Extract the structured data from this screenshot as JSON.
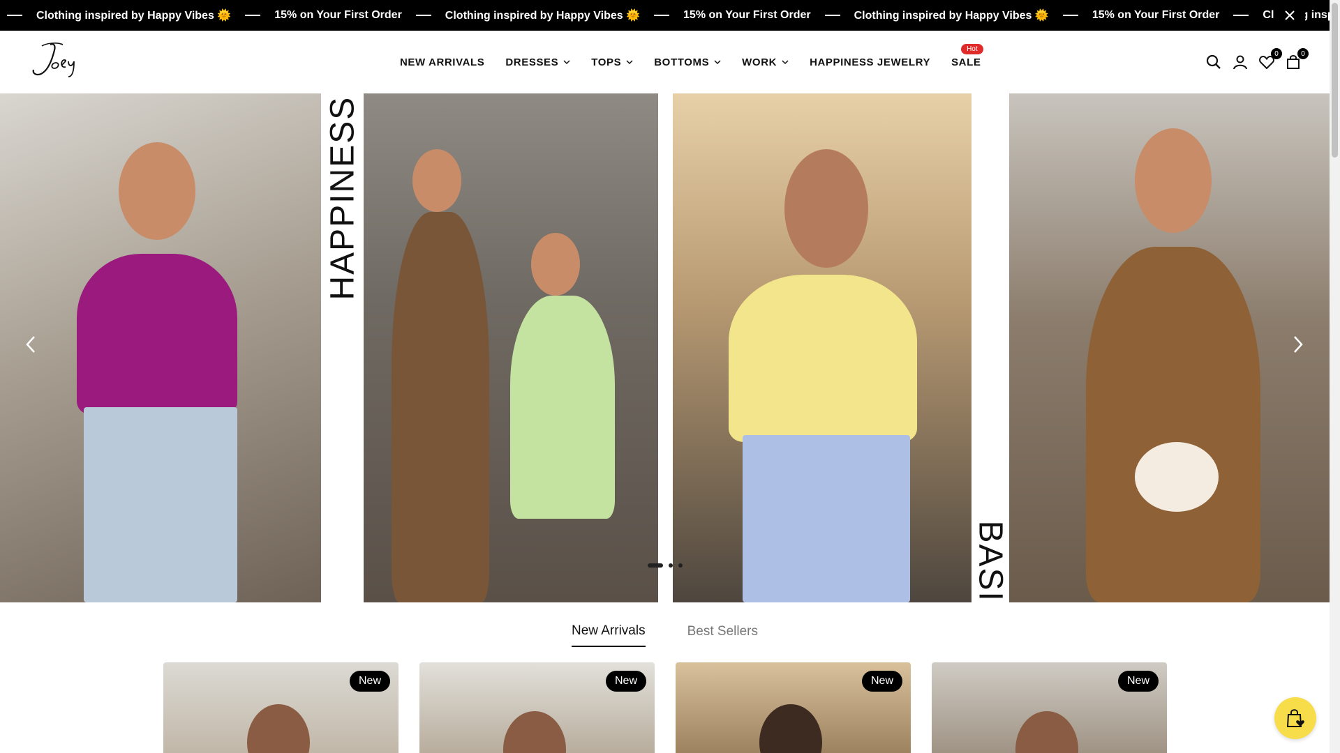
{
  "announcement": {
    "messages": [
      "Clothing inspired by Happy Vibes",
      "15% on Your First Order",
      "Clothing inspired by Happy Vibes",
      "15% on Your First Order",
      "Clothing inspired by Happy Vibes",
      "15% on Your First Order",
      "Clothing inspired"
    ],
    "sun_glyph": "🌞"
  },
  "header": {
    "logo_text": "Joey",
    "nav": [
      {
        "label": "NEW ARRIVALS",
        "dropdown": false
      },
      {
        "label": "DRESSES",
        "dropdown": true
      },
      {
        "label": "TOPS",
        "dropdown": true
      },
      {
        "label": "BOTTOMS",
        "dropdown": true
      },
      {
        "label": "WORK",
        "dropdown": true
      },
      {
        "label": "HAPPINESS JEWELRY",
        "dropdown": false
      },
      {
        "label": "SALE",
        "dropdown": false,
        "badge": "Hot"
      }
    ],
    "wishlist_count": "0",
    "cart_count": "0"
  },
  "hero": {
    "left_word": "HAPPINESS",
    "right_word": "BASICS",
    "slide_count": 3,
    "active_slide": 1
  },
  "tabs": [
    "New Arrivals",
    "Best Sellers"
  ],
  "products": [
    {
      "badge": "New"
    },
    {
      "badge": "New"
    },
    {
      "badge": "New"
    },
    {
      "badge": "New"
    }
  ],
  "colors": {
    "announcement_bg": "#000000",
    "hot_badge": "#e02b2b",
    "fab_bg": "#f7dd4a"
  }
}
